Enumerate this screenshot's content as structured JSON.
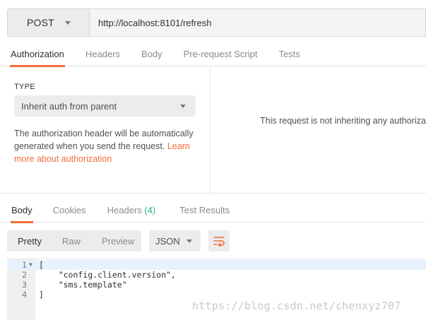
{
  "request": {
    "method": "POST",
    "url": "http://localhost:8101/refresh"
  },
  "request_tabs": [
    {
      "label": "Authorization",
      "active": true
    },
    {
      "label": "Headers",
      "active": false
    },
    {
      "label": "Body",
      "active": false
    },
    {
      "label": "Pre-request Script",
      "active": false
    },
    {
      "label": "Tests",
      "active": false
    }
  ],
  "auth": {
    "type_label": "TYPE",
    "selected_type": "Inherit auth from parent",
    "description": "The authorization header will be automatically generated when you send the request.",
    "learn_more": "Learn more about authorization",
    "right_message": "This request is not inheriting any authoriza"
  },
  "response_tabs": [
    {
      "label": "Body",
      "active": true
    },
    {
      "label": "Cookies",
      "active": false
    },
    {
      "label": "Headers",
      "count": "(4)",
      "active": false
    },
    {
      "label": "Test Results",
      "active": false
    }
  ],
  "view_modes": {
    "pretty": "Pretty",
    "raw": "Raw",
    "preview": "Preview"
  },
  "format": "JSON",
  "icons": {
    "method_caret": "chevron-down-icon",
    "wrap": "wrap-lines-icon",
    "fold": "fold-arrow-icon"
  },
  "colors": {
    "accent": "#f26b3a",
    "count": "#26b47f",
    "string": "#1c4fb0"
  },
  "code_lines": [
    {
      "num": "1",
      "text": "["
    },
    {
      "num": "2",
      "text": "    \"config.client.version\","
    },
    {
      "num": "3",
      "text": "    \"sms.template\""
    },
    {
      "num": "4",
      "text": "]"
    }
  ],
  "watermark": "https://blog.csdn.net/chenxyz707"
}
